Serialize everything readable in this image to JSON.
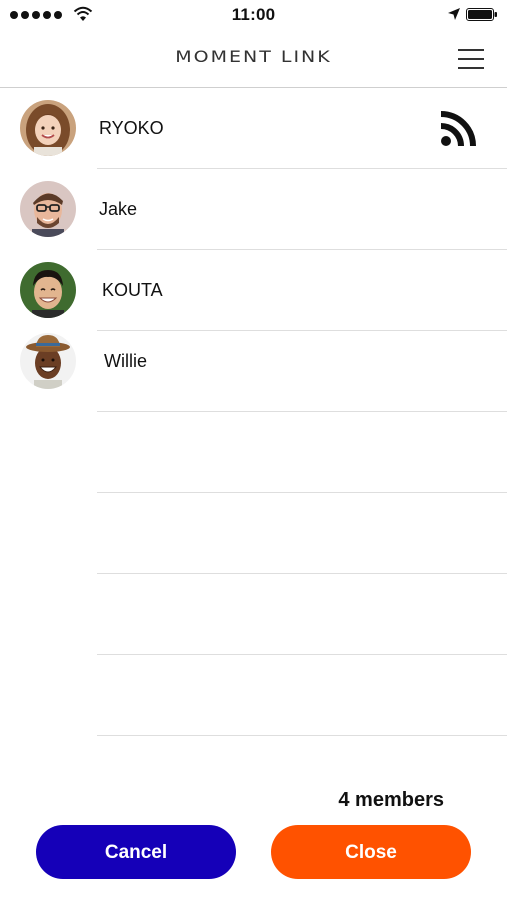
{
  "status_bar": {
    "time": "11:00",
    "signal_icon": "signal-dots-icon",
    "wifi_icon": "wifi-icon",
    "location_icon": "location-arrow-icon",
    "battery_icon": "battery-icon"
  },
  "header": {
    "title": "MOMENT LINK",
    "menu_icon": "hamburger-menu-icon"
  },
  "members": [
    {
      "name": "RYOKO",
      "avatar": "avatar-ryoko",
      "broadcasting": true,
      "broadcast_icon": "rss-feed-icon"
    },
    {
      "name": "Jake",
      "avatar": "avatar-jake",
      "broadcasting": false
    },
    {
      "name": "KOUTA",
      "avatar": "avatar-kouta",
      "broadcasting": false
    },
    {
      "name": "Willie",
      "avatar": "avatar-willie",
      "broadcasting": false
    }
  ],
  "footer": {
    "members_count": "4 members",
    "cancel_label": "Cancel",
    "close_label": "Close"
  },
  "colors": {
    "cancel_button": "#1500b8",
    "close_button": "#ff5200"
  }
}
